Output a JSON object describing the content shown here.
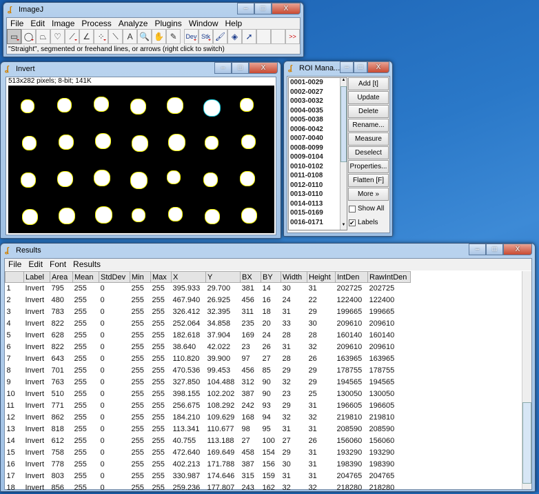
{
  "imagej": {
    "title": "ImageJ",
    "menu": [
      "File",
      "Edit",
      "Image",
      "Process",
      "Analyze",
      "Plugins",
      "Window",
      "Help"
    ],
    "tools": [
      "rectangle-tool",
      "oval-tool",
      "polygon-tool",
      "freehand-tool",
      "line-tool",
      "angle-tool",
      "multipoint-tool",
      "wand-tool",
      "text-tool",
      "magnifier-tool",
      "hand-tool",
      "color-picker-tool"
    ],
    "extra_tools": {
      "dev": "Dev",
      "stk": "Stk",
      "more": ">>"
    },
    "status": "\"Straight\", segmented or freehand lines, or arrows (right click to switch)"
  },
  "invert": {
    "title": "Invert",
    "info": "513x282 pixels; 8-bit; 141K"
  },
  "roi": {
    "title": "ROI Mana...",
    "items": [
      "0001-0029",
      "0002-0027",
      "0003-0032",
      "0004-0035",
      "0005-0038",
      "0006-0042",
      "0007-0040",
      "0008-0099",
      "0009-0104",
      "0010-0102",
      "0011-0108",
      "0012-0110",
      "0013-0110",
      "0014-0113",
      "0015-0169",
      "0016-0171"
    ],
    "buttons": [
      "Add [t]",
      "Update",
      "Delete",
      "Rename...",
      "Measure",
      "Deselect",
      "Properties...",
      "Flatten [F]",
      "More »"
    ],
    "show_all": "Show All",
    "labels": "Labels",
    "show_all_checked": false,
    "labels_checked": true
  },
  "results": {
    "title": "Results",
    "menu": [
      "File",
      "Edit",
      "Font",
      "Results"
    ],
    "columns": [
      "",
      "Label",
      "Area",
      "Mean",
      "StdDev",
      "Min",
      "Max",
      "X",
      "Y",
      "BX",
      "BY",
      "Width",
      "Height",
      "IntDen",
      "RawIntDen"
    ],
    "rows": [
      [
        "1",
        "Invert",
        "795",
        "255",
        "0",
        "255",
        "255",
        "395.933",
        "29.700",
        "381",
        "14",
        "30",
        "31",
        "202725",
        "202725"
      ],
      [
        "2",
        "Invert",
        "480",
        "255",
        "0",
        "255",
        "255",
        "467.940",
        "26.925",
        "456",
        "16",
        "24",
        "22",
        "122400",
        "122400"
      ],
      [
        "3",
        "Invert",
        "783",
        "255",
        "0",
        "255",
        "255",
        "326.412",
        "32.395",
        "311",
        "18",
        "31",
        "29",
        "199665",
        "199665"
      ],
      [
        "4",
        "Invert",
        "822",
        "255",
        "0",
        "255",
        "255",
        "252.064",
        "34.858",
        "235",
        "20",
        "33",
        "30",
        "209610",
        "209610"
      ],
      [
        "5",
        "Invert",
        "628",
        "255",
        "0",
        "255",
        "255",
        "182.618",
        "37.904",
        "169",
        "24",
        "28",
        "28",
        "160140",
        "160140"
      ],
      [
        "6",
        "Invert",
        "822",
        "255",
        "0",
        "255",
        "255",
        "38.640",
        "42.022",
        "23",
        "26",
        "31",
        "32",
        "209610",
        "209610"
      ],
      [
        "7",
        "Invert",
        "643",
        "255",
        "0",
        "255",
        "255",
        "110.820",
        "39.900",
        "97",
        "27",
        "28",
        "26",
        "163965",
        "163965"
      ],
      [
        "8",
        "Invert",
        "701",
        "255",
        "0",
        "255",
        "255",
        "470.536",
        "99.453",
        "456",
        "85",
        "29",
        "29",
        "178755",
        "178755"
      ],
      [
        "9",
        "Invert",
        "763",
        "255",
        "0",
        "255",
        "255",
        "327.850",
        "104.488",
        "312",
        "90",
        "32",
        "29",
        "194565",
        "194565"
      ],
      [
        "10",
        "Invert",
        "510",
        "255",
        "0",
        "255",
        "255",
        "398.155",
        "102.202",
        "387",
        "90",
        "23",
        "25",
        "130050",
        "130050"
      ],
      [
        "11",
        "Invert",
        "771",
        "255",
        "0",
        "255",
        "255",
        "256.675",
        "108.292",
        "242",
        "93",
        "29",
        "31",
        "196605",
        "196605"
      ],
      [
        "12",
        "Invert",
        "862",
        "255",
        "0",
        "255",
        "255",
        "184.210",
        "109.629",
        "168",
        "94",
        "32",
        "32",
        "219810",
        "219810"
      ],
      [
        "13",
        "Invert",
        "818",
        "255",
        "0",
        "255",
        "255",
        "113.341",
        "110.677",
        "98",
        "95",
        "31",
        "31",
        "208590",
        "208590"
      ],
      [
        "14",
        "Invert",
        "612",
        "255",
        "0",
        "255",
        "255",
        "40.755",
        "113.188",
        "27",
        "100",
        "27",
        "26",
        "156060",
        "156060"
      ],
      [
        "15",
        "Invert",
        "758",
        "255",
        "0",
        "255",
        "255",
        "472.640",
        "169.649",
        "458",
        "154",
        "29",
        "31",
        "193290",
        "193290"
      ],
      [
        "16",
        "Invert",
        "778",
        "255",
        "0",
        "255",
        "255",
        "402.213",
        "171.788",
        "387",
        "156",
        "30",
        "31",
        "198390",
        "198390"
      ],
      [
        "17",
        "Invert",
        "803",
        "255",
        "0",
        "255",
        "255",
        "330.987",
        "174.646",
        "315",
        "159",
        "31",
        "31",
        "204765",
        "204765"
      ],
      [
        "18",
        "Invert",
        "856",
        "255",
        "0",
        "255",
        "255",
        "259.236",
        "177.807",
        "243",
        "162",
        "32",
        "32",
        "218280",
        "218280"
      ]
    ]
  },
  "window_controls": {
    "minimize": "–",
    "maximize": "□",
    "close": "X"
  }
}
